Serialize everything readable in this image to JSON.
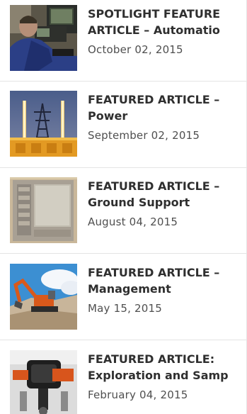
{
  "articles": [
    {
      "title_line1": "SPOTLIGHT FEATURE",
      "title_line2": "ARTICLE – Automatio",
      "date": "October 02, 2015"
    },
    {
      "title_line1": "FEATURED ARTICLE –",
      "title_line2": "Power",
      "date": "September 02, 2015"
    },
    {
      "title_line1": "FEATURED ARTICLE –",
      "title_line2": "Ground Support",
      "date": "August 04, 2015"
    },
    {
      "title_line1": "FEATURED ARTICLE –",
      "title_line2": "Management",
      "date": "May 15, 2015"
    },
    {
      "title_line1": "FEATURED ARTICLE:",
      "title_line2": "Exploration and Samp",
      "date": "February 04, 2015"
    }
  ],
  "colors": {
    "title": "#2f2f2f",
    "date": "#4f4f4f",
    "divider": "#e4e4e4"
  }
}
